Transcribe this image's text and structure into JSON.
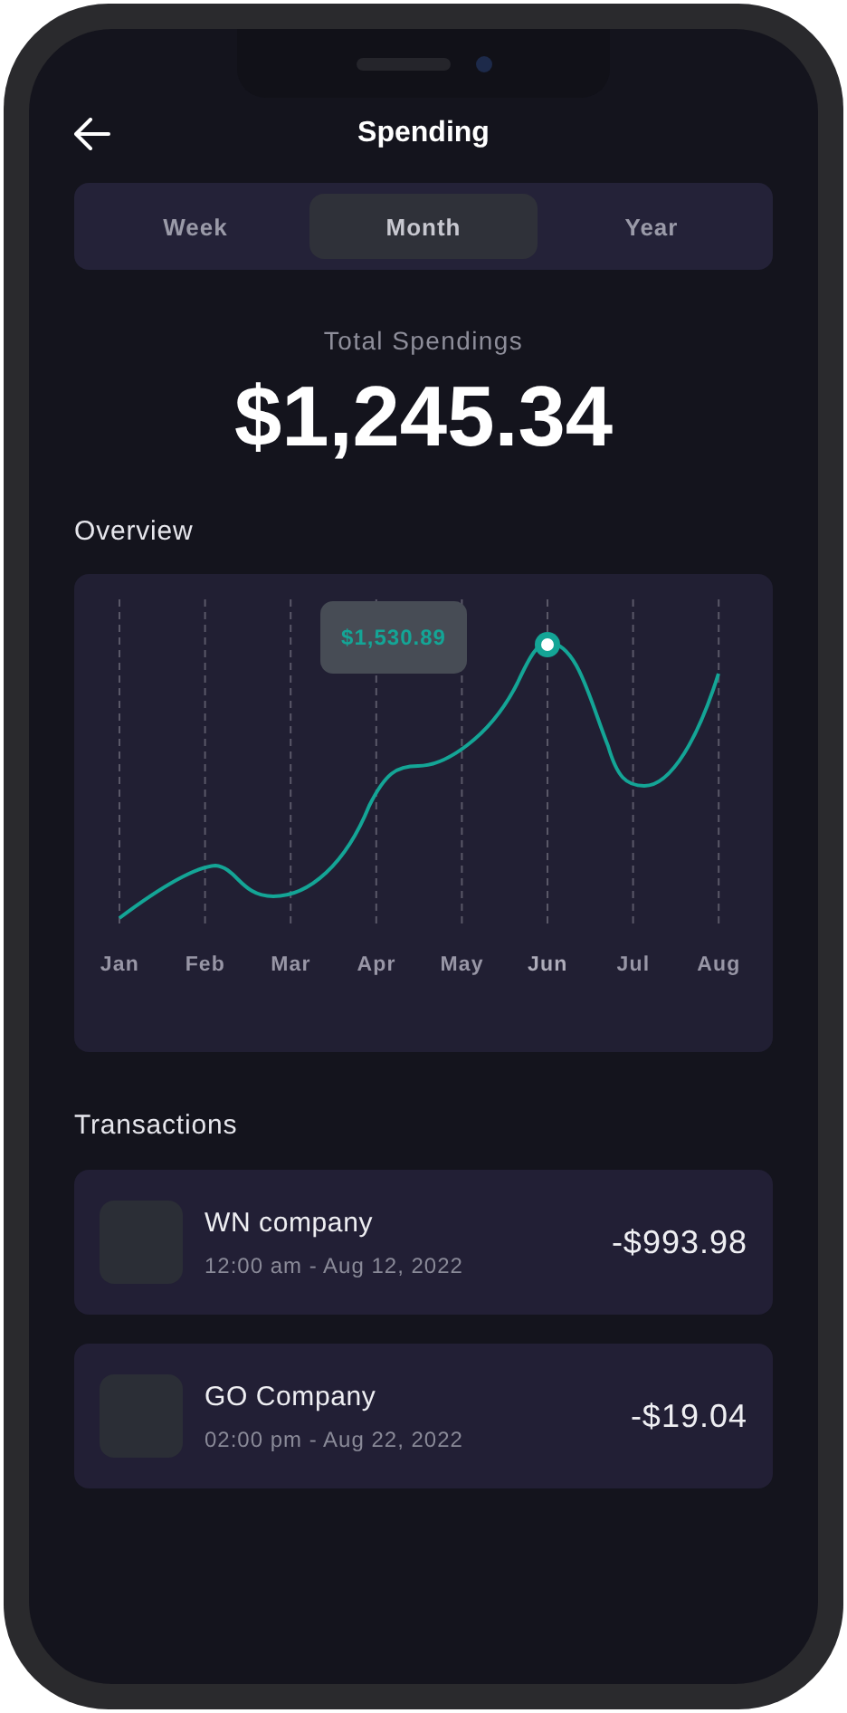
{
  "header": {
    "title": "Spending"
  },
  "tabs": [
    {
      "label": "Week",
      "selected": false
    },
    {
      "label": "Month",
      "selected": true
    },
    {
      "label": "Year",
      "selected": false
    }
  ],
  "total": {
    "label": "Total Spendings",
    "amount": "$1,245.34"
  },
  "overview": {
    "title": "Overview",
    "tooltip": "$1,530.89",
    "months": [
      {
        "label": "Jan",
        "selected": false
      },
      {
        "label": "Feb",
        "selected": false
      },
      {
        "label": "Mar",
        "selected": false
      },
      {
        "label": "Apr",
        "selected": false
      },
      {
        "label": "May",
        "selected": false
      },
      {
        "label": "Jun",
        "selected": true
      },
      {
        "label": "Jul",
        "selected": false
      },
      {
        "label": "Aug",
        "selected": false
      }
    ]
  },
  "transactions": {
    "title": "Transactions",
    "items": [
      {
        "name": "WN company",
        "time": "12:00 am - Aug 12, 2022",
        "amount": "-$993.98"
      },
      {
        "name": "GO Company",
        "time": "02:00 pm - Aug 22, 2022",
        "amount": "-$19.04"
      }
    ]
  }
}
